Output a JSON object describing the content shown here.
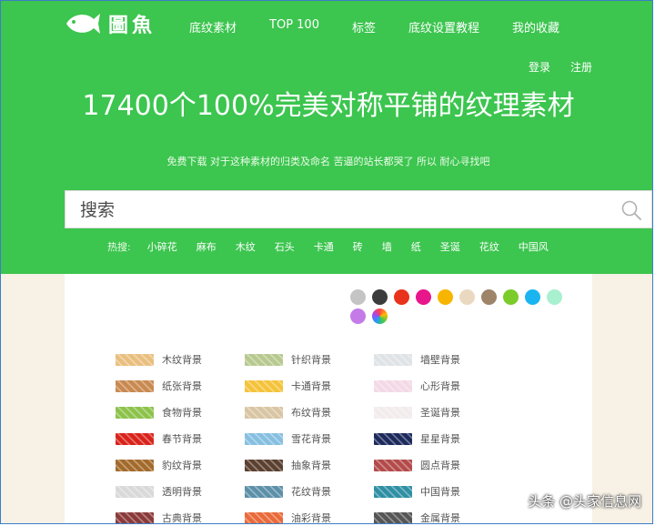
{
  "brand": {
    "logo_text": "圖魚"
  },
  "nav": [
    "底纹素材",
    "TOP 100",
    "标签",
    "底纹设置教程",
    "我的收藏"
  ],
  "auth": {
    "login": "登录",
    "register": "注册"
  },
  "headline": "17400个100%完美对称平铺的纹理素材",
  "subtitle": "免费下载 对于这种素材的归类及命名 苦逼的站长都哭了 所以 耐心寻找吧",
  "search": {
    "placeholder": "搜索"
  },
  "hot_tags": {
    "label": "热搜:",
    "items": [
      "小碎花",
      "麻布",
      "木纹",
      "石头",
      "卡通",
      "砖",
      "墙",
      "纸",
      "圣诞",
      "花纹",
      "中国风"
    ]
  },
  "color_filters": [
    "#c4c4c4",
    "#3c3c3c",
    "#e8341c",
    "#e8168b",
    "#f7b500",
    "#ead9c0",
    "#9e8468",
    "#7bcc2a",
    "#1ab5f0",
    "#a8f0d0",
    "#c47be8",
    "rainbow"
  ],
  "categories": [
    [
      {
        "label": "木纹背景",
        "color": "#e9bf7f"
      },
      {
        "label": "针织背景",
        "color": "#b7c98f"
      },
      {
        "label": "墙壁背景",
        "color": "#dfe3e6"
      }
    ],
    [
      {
        "label": "纸张背景",
        "color": "#c98950"
      },
      {
        "label": "卡通背景",
        "color": "#f5c33a"
      },
      {
        "label": "心形背景",
        "color": "#f4d9e6"
      }
    ],
    [
      {
        "label": "食物背景",
        "color": "#8cc24a"
      },
      {
        "label": "布纹背景",
        "color": "#d9c5a3"
      },
      {
        "label": "圣诞背景",
        "color": "#f2ecec"
      }
    ],
    [
      {
        "label": "春节背景",
        "color": "#d8231b"
      },
      {
        "label": "雪花背景",
        "color": "#86bfe0"
      },
      {
        "label": "星星背景",
        "color": "#1d2a5c"
      }
    ],
    [
      {
        "label": "豹纹背景",
        "color": "#a36a2b"
      },
      {
        "label": "抽象背景",
        "color": "#5b4030"
      },
      {
        "label": "圆点背景",
        "color": "#b44a4a"
      }
    ],
    [
      {
        "label": "透明背景",
        "color": "#d9d9d9"
      },
      {
        "label": "花纹背景",
        "color": "#5c8fa8"
      },
      {
        "label": "中国背景",
        "color": "#2f8fa3"
      }
    ],
    [
      {
        "label": "古典背景",
        "color": "#8b3a3a"
      },
      {
        "label": "油彩背景",
        "color": "#e96a3a"
      },
      {
        "label": "金属背景",
        "color": "#555555"
      }
    ]
  ],
  "watermark": "头条 @头家信息网"
}
